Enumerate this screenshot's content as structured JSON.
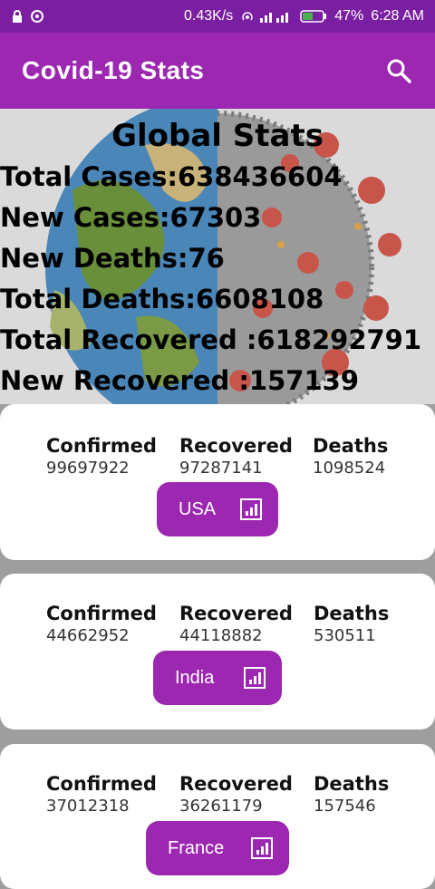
{
  "status_bar": {
    "speed": "0.43K/s",
    "battery": "47%",
    "time": "6:28 AM"
  },
  "app_bar": {
    "title": "Covid-19 Stats"
  },
  "global": {
    "title": "Global Stats",
    "lines": [
      "Total Cases:638436604",
      "New Cases:67303",
      "New Deaths:76",
      "Total Deaths:6608108",
      "Total Recovered :618292791",
      "New Recovered :157139"
    ]
  },
  "labels": {
    "confirmed": "Confirmed",
    "recovered": "Recovered",
    "deaths": "Deaths"
  },
  "countries": [
    {
      "name": "USA",
      "confirmed": "99697922",
      "recovered": "97287141",
      "deaths": "1098524"
    },
    {
      "name": "India",
      "confirmed": "44662952",
      "recovered": "44118882",
      "deaths": "530511"
    },
    {
      "name": "France",
      "confirmed": "37012318",
      "recovered": "36261179",
      "deaths": "157546"
    }
  ],
  "colors": {
    "primary": "#9c27b0",
    "status_bar": "#7b1fa2"
  }
}
